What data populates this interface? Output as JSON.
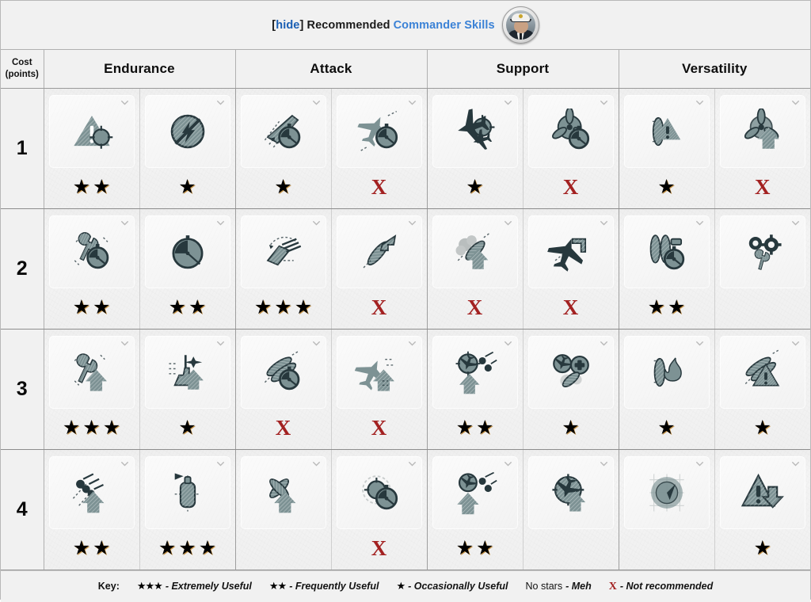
{
  "header": {
    "hide_label": "hide",
    "title_static": "Recommended",
    "title_link": "Commander Skills",
    "portrait_icon": "captain-portrait-icon"
  },
  "table": {
    "cost_header_line1": "Cost",
    "cost_header_line2": "(points)",
    "columns": [
      "Endurance",
      "Attack",
      "Support",
      "Versatility"
    ],
    "rows": [
      {
        "cost": "1",
        "cells": [
          {
            "icon": "priority-target-icon",
            "rating": "★★"
          },
          {
            "icon": "no-detonation-icon",
            "rating": "★"
          },
          {
            "icon": "ship-reload-timer-icon",
            "rating": "★"
          },
          {
            "icon": "plane-reload-timer-icon",
            "rating": "X"
          },
          {
            "icon": "dual-aircraft-spotter-icon",
            "rating": "★"
          },
          {
            "icon": "propeller-timer-icon",
            "rating": "X"
          },
          {
            "icon": "torpedo-warning-icon",
            "rating": "★"
          },
          {
            "icon": "propeller-boost-icon",
            "rating": "X"
          }
        ]
      },
      {
        "cost": "2",
        "cells": [
          {
            "icon": "wrench-timer-icon",
            "rating": "★★"
          },
          {
            "icon": "stopwatch-icon",
            "rating": "★★"
          },
          {
            "icon": "secondary-battery-arc-icon",
            "rating": "★★★"
          },
          {
            "icon": "torpedo-speed-arrow-icon",
            "rating": "X"
          },
          {
            "icon": "smoke-boost-icon",
            "rating": "X"
          },
          {
            "icon": "plane-boost-icon",
            "rating": "X"
          },
          {
            "icon": "torpedo-reload-timer-icon",
            "rating": "★★"
          },
          {
            "icon": "gears-wrench-icon",
            "rating": ""
          }
        ]
      },
      {
        "cost": "3",
        "cells": [
          {
            "icon": "wrench-boost-icon",
            "rating": "★★★"
          },
          {
            "icon": "carrier-boost-icon",
            "rating": "★"
          },
          {
            "icon": "torpedo-tubes-timer-icon",
            "rating": "X"
          },
          {
            "icon": "plane-up-arrow-icon",
            "rating": "X"
          },
          {
            "icon": "aa-boost-icon",
            "rating": "★★"
          },
          {
            "icon": "aircraft-heal-icon",
            "rating": "★"
          },
          {
            "icon": "torpedo-fire-icon",
            "rating": "★"
          },
          {
            "icon": "torpedo-warning-tubes-icon",
            "rating": "★"
          }
        ]
      },
      {
        "cost": "4",
        "cells": [
          {
            "icon": "incoming-fire-boost-icon",
            "rating": "★★"
          },
          {
            "icon": "smoke-generator-icon",
            "rating": "★★★"
          },
          {
            "icon": "torpedo-cross-boost-icon",
            "rating": ""
          },
          {
            "icon": "radar-timer-icon",
            "rating": "X"
          },
          {
            "icon": "aa-flak-boost-icon",
            "rating": "★★"
          },
          {
            "icon": "fighter-boost-icon",
            "rating": ""
          },
          {
            "icon": "radar-sweep-icon",
            "rating": ""
          },
          {
            "icon": "alert-down-arrow-icon",
            "rating": "★"
          }
        ]
      }
    ]
  },
  "footer": {
    "key_label": "Key:",
    "items": [
      {
        "symbol": "★★★",
        "type": "star",
        "desc": "- Extremely Useful"
      },
      {
        "symbol": "★★",
        "type": "star",
        "desc": "- Frequently Useful"
      },
      {
        "symbol": "★",
        "type": "star",
        "desc": "- Occasionally Useful"
      },
      {
        "symbol": "No stars",
        "type": "text",
        "desc": "- Meh"
      },
      {
        "symbol": "X",
        "type": "x",
        "desc": "- Not recommended"
      }
    ]
  },
  "colors": {
    "icon_light": "#7d9294",
    "icon_dark": "#27383d",
    "x_red": "#a32121",
    "link_blue": "#3b82d6",
    "hide_blue": "#1a5fb4"
  }
}
